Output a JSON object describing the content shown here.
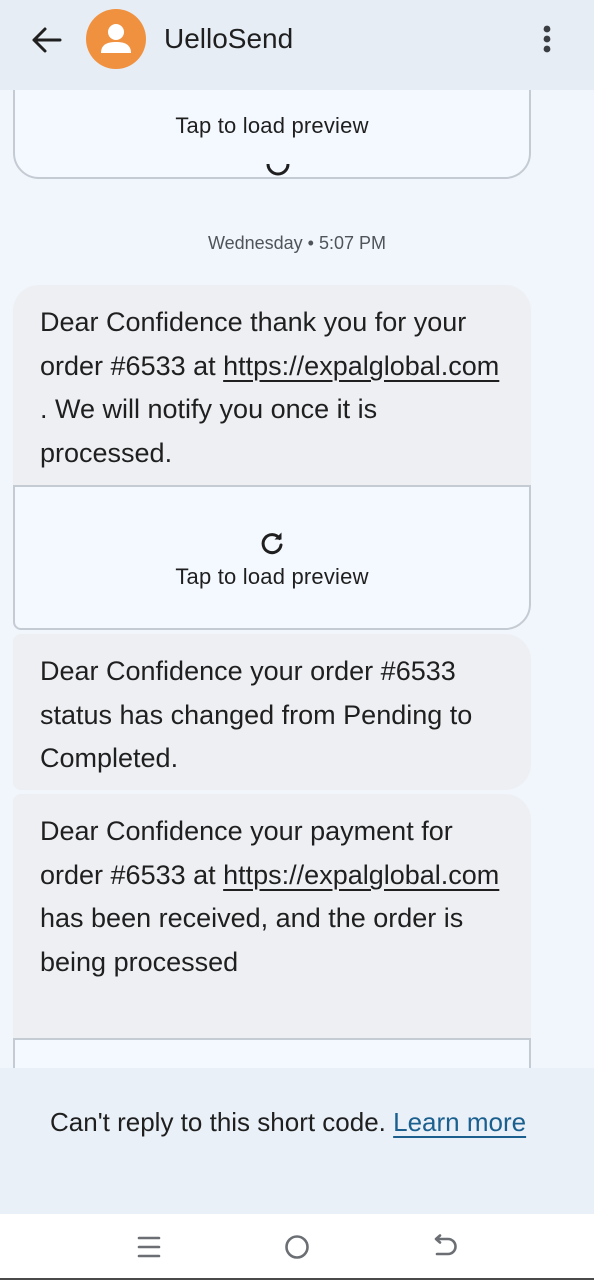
{
  "header": {
    "back_icon": "arrow-back-icon",
    "avatar_icon": "person-icon",
    "sender_name": "UelloSend",
    "more_icon": "more-vert-icon",
    "avatar_color": "#f0913f"
  },
  "conversation": {
    "top_preview": {
      "label": "Tap to load preview",
      "icon": "refresh-icon"
    },
    "timestamp": "Wednesday • 5:07 PM",
    "messages": [
      {
        "before_link": "Dear Confidence thank you for your order #6533 at ",
        "link": "https://expalglobal.com",
        "after_link": " . We will notify you once it is processed.",
        "preview": {
          "label": "Tap to load preview",
          "icon": "refresh-icon"
        }
      },
      {
        "text": "Dear Confidence your order #6533 status has changed from Pending to Completed."
      },
      {
        "before_link": "Dear Confidence your payment for order #6533 at ",
        "link": "https://expalglobal.com",
        "after_link": " has been received, and the order is being processed"
      }
    ]
  },
  "footer": {
    "note": "Can't reply to this short code. ",
    "learn_more": "Learn more"
  },
  "nav_bar": {
    "recent_icon": "recent-apps-icon",
    "home_icon": "home-circle-icon",
    "back_icon": "back-gesture-icon"
  }
}
